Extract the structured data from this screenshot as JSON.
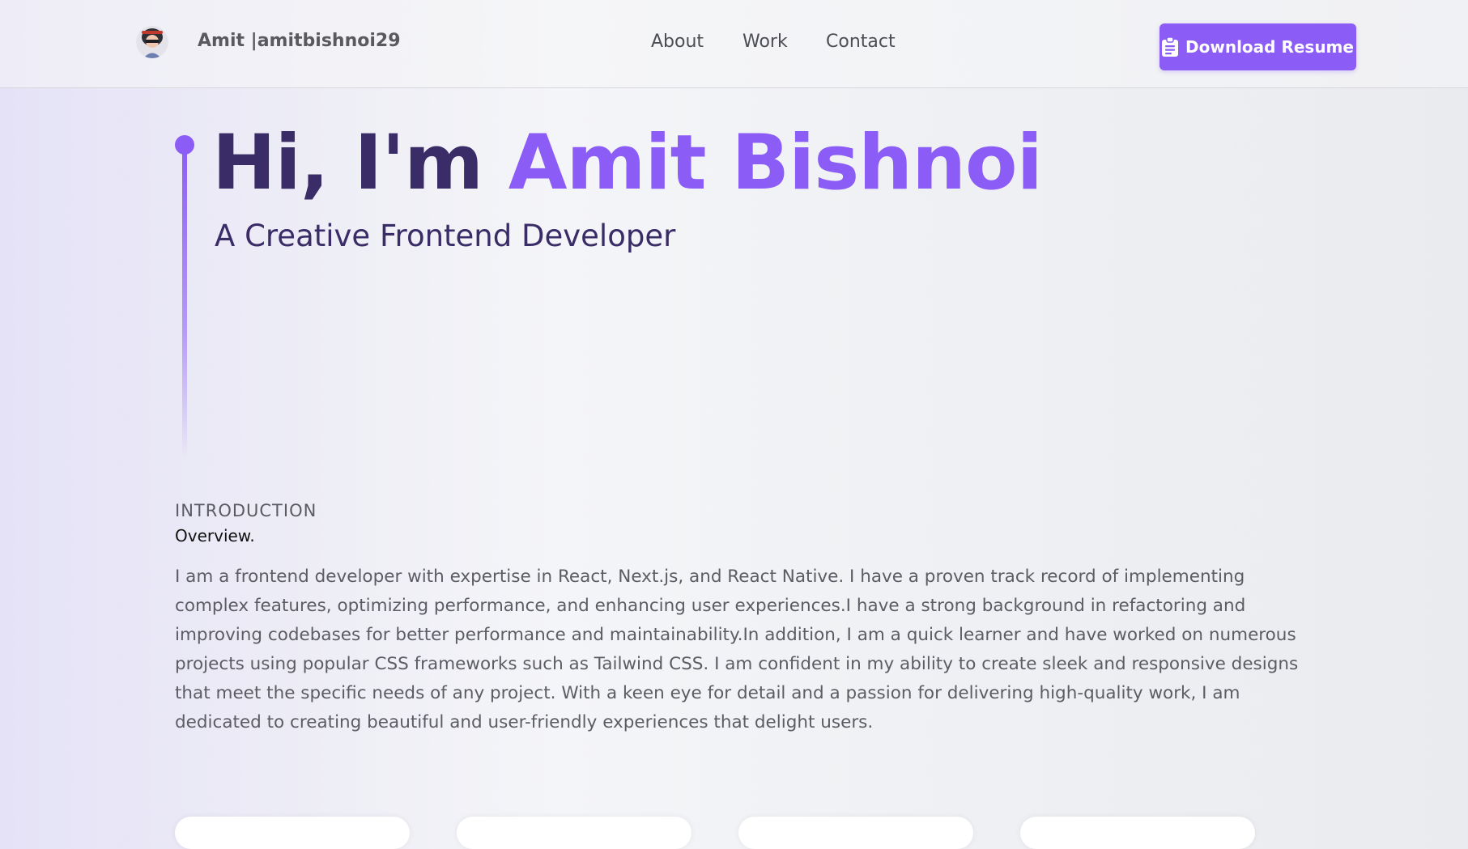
{
  "navbar": {
    "brand": "Amit |amitbishnoi29",
    "links": [
      "About",
      "Work",
      "Contact"
    ],
    "resume_label": "Download Resume",
    "resume_icon": "clipboard-icon"
  },
  "hero": {
    "greeting": "Hi, I'm ",
    "name": "Amit Bishnoi",
    "subtitle": "A Creative Frontend Developer"
  },
  "intro": {
    "label": "INTRODUCTION",
    "title": "Overview.",
    "text": "I am a frontend developer with expertise in React, Next.js, and React Native. I have a proven track record of implementing complex features, optimizing performance, and enhancing user experiences.I have a strong background in refactoring and improving codebases for better performance and maintainability.In addition, I am a quick learner and have worked on numerous projects using popular CSS frameworks such as Tailwind CSS. I am confident in my ability to create sleek and responsive designs that meet the specific needs of any project. With a keen eye for detail and a passion for delivering high-quality work, I am dedicated to creating beautiful and user-friendly experiences that delight users."
  },
  "colors": {
    "accent": "#8b5cf6",
    "heading": "#3a2c67"
  }
}
